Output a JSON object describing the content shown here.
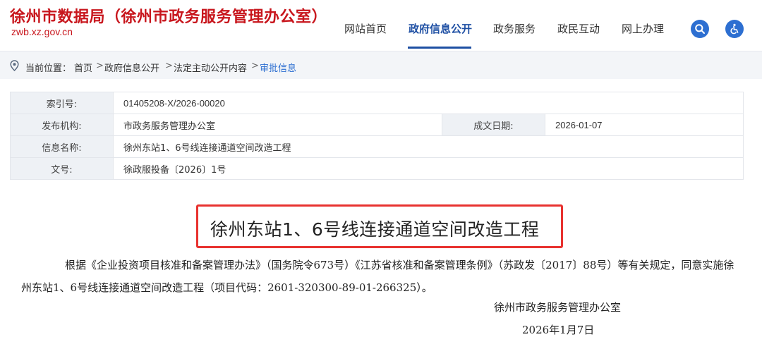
{
  "header": {
    "site_title": "徐州市数据局（徐州市政务服务管理办公室）",
    "site_domain": "zwb.xz.gov.cn",
    "nav": [
      "网站首页",
      "政府信息公开",
      "政务服务",
      "政民互动",
      "网上办理"
    ],
    "active_nav": "政府信息公开",
    "search_icon": "search-icon",
    "accessibility_icon": "wheelchair-icon",
    "accent_color": "#1e4fa3",
    "brand_color": "#c8161d"
  },
  "breadcrumb": {
    "label": "当前位置：",
    "items": [
      "首页",
      "政府信息公开",
      "法定主动公开内容",
      "审批信息"
    ],
    "separator": ">"
  },
  "info": {
    "index_label": "索引号:",
    "index_value": "01405208-X/2026-00020",
    "publisher_label": "发布机构:",
    "publisher_value": "市政务服务管理办公室",
    "date_label": "成文日期:",
    "date_value": "2026-01-07",
    "name_label": "信息名称:",
    "name_value": "徐州东站1、6号线连接通道空间改造工程",
    "docno_label": "文号:",
    "docno_value": "徐政服投备〔2026〕1号"
  },
  "article": {
    "headline": "徐州东站1、6号线连接通道空间改造工程",
    "body": "根据《企业投资项目核准和备案管理办法》（国务院令673号）《江苏省核准和备案管理条例》（苏政发〔2017〕88号）等有关规定，同意实施徐州东站1、6号线连接通道空间改造工程（项目代码：2601-320300-89-01-266325）。",
    "signature": "徐州市政务服务管理办公室",
    "date": "2026年1月7日",
    "highlight_color": "#e8322f"
  }
}
